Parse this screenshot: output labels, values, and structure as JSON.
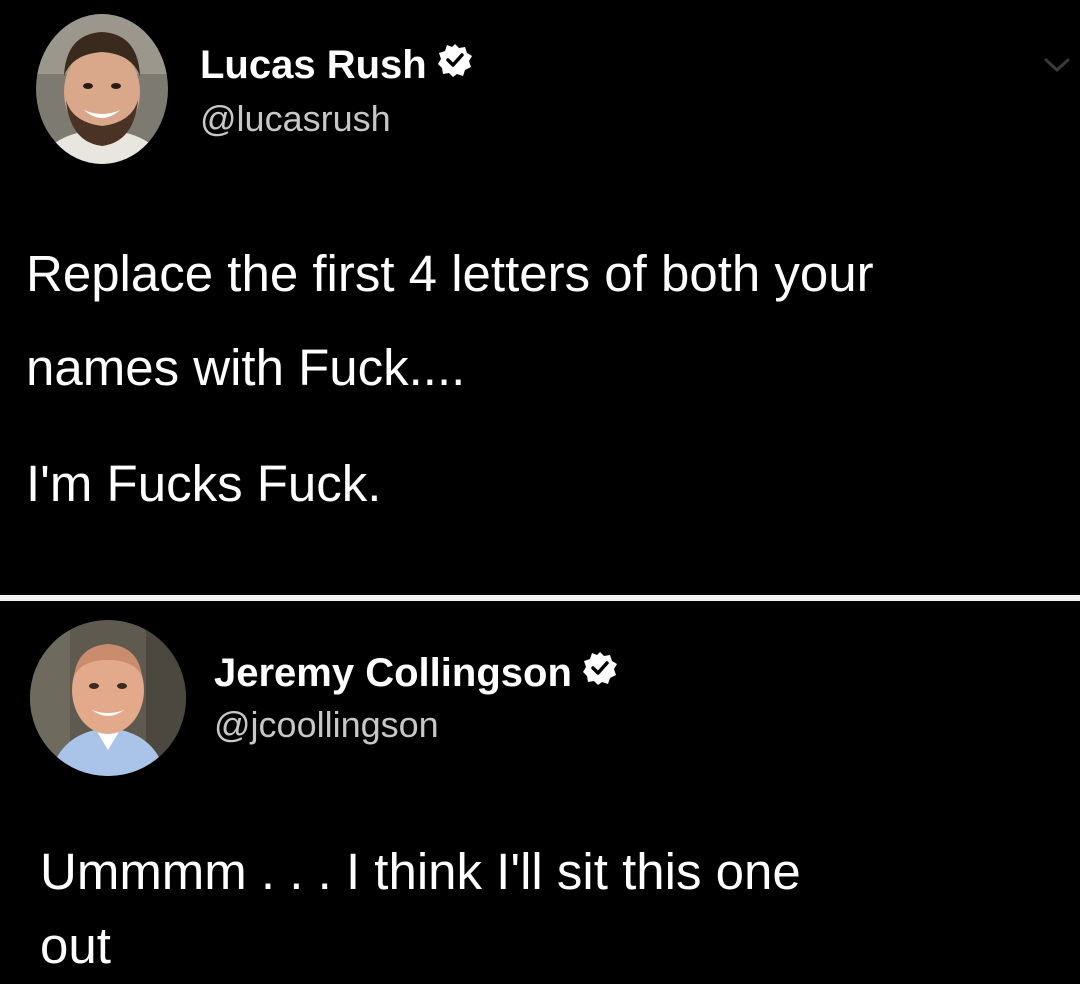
{
  "colors": {
    "background": "#000000",
    "text": "#ffffff",
    "handle": "#c7c7c7",
    "divider": "#f2f2f2",
    "verified_badge": "#ffffff"
  },
  "tweets": [
    {
      "author": {
        "display_name": "Lucas Rush",
        "handle": "@lucasrush",
        "verified": true,
        "avatar_icon": "avatar-photo-bearded-man"
      },
      "body_lines": [
        "Replace the first 4 letters of both your",
        "names with Fuck....",
        "I'm Fucks Fuck."
      ],
      "menu_icon": "chevron-down-icon"
    },
    {
      "author": {
        "display_name": "Jeremy Collingson",
        "handle": "@jcoollingson",
        "verified": true,
        "avatar_icon": "avatar-photo-smiling-man"
      },
      "body_lines": [
        "Ummmm . . . I think I'll sit this one",
        "out"
      ]
    }
  ]
}
